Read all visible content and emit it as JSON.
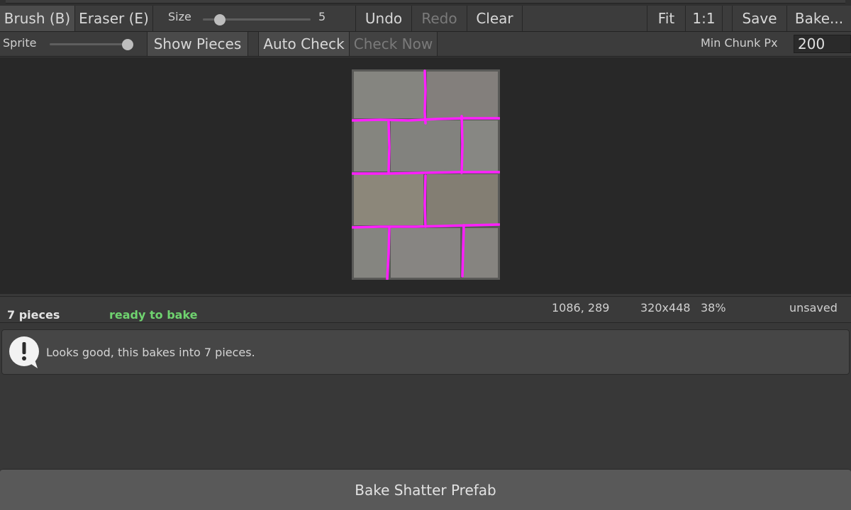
{
  "toolbar": {
    "brush_label": "Brush (B)",
    "eraser_label": "Eraser (E)",
    "size_label": "Size",
    "size_value": "5",
    "undo_label": "Undo",
    "redo_label": "Redo",
    "clear_label": "Clear",
    "fit_label": "Fit",
    "one_to_one_label": "1:1",
    "save_label": "Save",
    "bake_menu_label": "Bake..."
  },
  "toolbar2": {
    "sprite_label": "Sprite",
    "show_pieces_label": "Show Pieces",
    "auto_check_label": "Auto Check",
    "check_now_label": "Check Now",
    "min_chunk_label": "Min Chunk Px",
    "min_chunk_value": "200"
  },
  "sliders": {
    "size_fraction": 0.1,
    "sprite_fraction": 1.0
  },
  "status": {
    "pieces": "7 pieces",
    "state": "ready to bake",
    "cursor": "1086, 289",
    "dimensions": "320x448",
    "zoom": "38%",
    "save_state": "unsaved"
  },
  "message": {
    "text": "Looks good, this bakes into 7 pieces."
  },
  "bake_button_label": "Bake Shatter Prefab",
  "colors": {
    "cut_line": "#ff1fff",
    "ready_green": "#6fd36f",
    "brick": "#858580",
    "brick_warm": "#8c877a"
  }
}
